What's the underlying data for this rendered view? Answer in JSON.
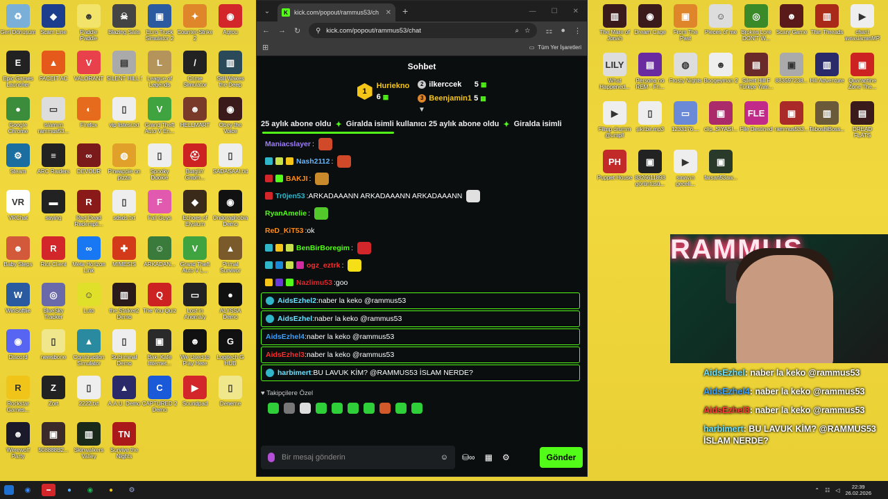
{
  "desktop": {
    "left_icons": [
      {
        "label": "Geri Dönüşüm",
        "color": "#7ab0d8",
        "glyph": "♻"
      },
      {
        "label": "Scam Line",
        "color": "#1c3e8c",
        "glyph": "◆"
      },
      {
        "label": "Paddle Paddle",
        "color": "#f2e46b",
        "glyph": "☻"
      },
      {
        "label": "Blazing Sails",
        "color": "#444",
        "glyph": "☠"
      },
      {
        "label": "Euro Truck Simulator 2",
        "color": "#2c5aa0",
        "glyph": "▣"
      },
      {
        "label": "Counter-Strike 2",
        "color": "#e0862a",
        "glyph": "✦"
      },
      {
        "label": "Agrou",
        "color": "#d2262a",
        "glyph": "◉"
      },
      {
        "label": "Epic Games Launcher",
        "color": "#222",
        "glyph": "E"
      },
      {
        "label": "FACEIT AC",
        "color": "#e55a1a",
        "glyph": "▲"
      },
      {
        "label": "VALORANT",
        "color": "#e8414b",
        "glyph": "V"
      },
      {
        "label": "SILENT HILL f",
        "color": "#aaa",
        "glyph": "▤"
      },
      {
        "label": "League of Legends",
        "color": "#b4945a",
        "glyph": "L"
      },
      {
        "label": "Crime Simulator",
        "color": "#222",
        "glyph": "/"
      },
      {
        "label": "Still Wakes the Deep",
        "color": "#2a4a5a",
        "glyph": "▥"
      },
      {
        "label": "Google Chrome",
        "color": "#3b8d3b",
        "glyph": "●"
      },
      {
        "label": "islamım rammus53...",
        "color": "#ddd",
        "glyph": "▭"
      },
      {
        "label": "Firefox",
        "color": "#e66b1c",
        "glyph": "◐"
      },
      {
        "label": "vip listesi.txt",
        "color": "#eee",
        "glyph": "▯"
      },
      {
        "label": "Grand Theft Auto V En...",
        "color": "#3fa33f",
        "glyph": "V"
      },
      {
        "label": "HELLMART",
        "color": "#7a3a2a",
        "glyph": "☻"
      },
      {
        "label": "Obey the Voice",
        "color": "#3a1a1a",
        "glyph": "◉"
      },
      {
        "label": "Steam",
        "color": "#1b6ea0",
        "glyph": "⚙"
      },
      {
        "label": "ARC Raiders",
        "color": "#222",
        "glyph": "≡"
      },
      {
        "label": "DEVOUR",
        "color": "#7a1a1a",
        "glyph": "∞"
      },
      {
        "label": "Pineapple on pizza",
        "color": "#e0a02a",
        "glyph": "◍"
      },
      {
        "label": "Spooky Dookie",
        "color": "#eee",
        "glyph": "▯"
      },
      {
        "label": "Burglin' Gnom...",
        "color": "#c22",
        "glyph": "⛑"
      },
      {
        "label": "SADASAAI.txt",
        "color": "#eee",
        "glyph": "▯"
      },
      {
        "label": "VRChat",
        "color": "#fff",
        "glyph": "VR"
      },
      {
        "label": "saying",
        "color": "#222",
        "glyph": "▬"
      },
      {
        "label": "Red Dead Redempti...",
        "color": "#8a1a1a",
        "glyph": "R"
      },
      {
        "label": "sdsds.txt",
        "color": "#eee",
        "glyph": "▯"
      },
      {
        "label": "Fall Guys",
        "color": "#e25ab0",
        "glyph": "F"
      },
      {
        "label": "Echoes of Elysium",
        "color": "#3a2a1a",
        "glyph": "◆"
      },
      {
        "label": "Ondoraphobia Demo",
        "color": "#111",
        "glyph": "◉"
      },
      {
        "label": "Baby Steps",
        "color": "#d25a3a",
        "glyph": "☻"
      },
      {
        "label": "Riot Client",
        "color": "#d2262a",
        "glyph": "R"
      },
      {
        "label": "Meta Horizon Link",
        "color": "#1877f2",
        "glyph": "∞"
      },
      {
        "label": "MIMESIS",
        "color": "#d23a1a",
        "glyph": "✚"
      },
      {
        "label": "ARKADAN...",
        "color": "#3a7a3a",
        "glyph": "☺"
      },
      {
        "label": "Grand Theft Auto V L...",
        "color": "#3fa33f",
        "glyph": "V"
      },
      {
        "label": "Primal Survivor",
        "color": "#7a5a2a",
        "glyph": "▲"
      },
      {
        "label": "WinSoftlie",
        "color": "#2a5aa0",
        "glyph": "W"
      },
      {
        "label": "BlueSky Tracker",
        "color": "#6a6aaa",
        "glyph": "◎"
      },
      {
        "label": "Luto",
        "color": "#e0e02a",
        "glyph": "☺"
      },
      {
        "label": "the Stalker2 Demo",
        "color": "#2a1a1a",
        "glyph": "▥"
      },
      {
        "label": "The You Quiz",
        "color": "#c22",
        "glyph": "Q"
      },
      {
        "label": "Lost in Anomaly",
        "color": "#222",
        "glyph": "▭"
      },
      {
        "label": "ALYSSA Demo",
        "color": "#111",
        "glyph": "●"
      },
      {
        "label": "Discord",
        "color": "#5865f2",
        "glyph": "◉"
      },
      {
        "label": "newsbone",
        "color": "#f0e68c",
        "glyph": "▯"
      },
      {
        "label": "Construction Simulator",
        "color": "#2a8aa0",
        "glyph": "▲"
      },
      {
        "label": "Subliminal Demo",
        "color": "#eee",
        "glyph": "▯"
      },
      {
        "label": "Bakı Kafe Internet...",
        "color": "#2a2a2a",
        "glyph": "▣"
      },
      {
        "label": "We Used to Play Here",
        "color": "#111",
        "glyph": "☻"
      },
      {
        "label": "Logitech G HUB",
        "color": "#111",
        "glyph": "G"
      },
      {
        "label": "Rockstar Games...",
        "color": "#f0c419",
        "glyph": "R"
      },
      {
        "label": "Zort",
        "color": "#222",
        "glyph": "Z"
      },
      {
        "label": "2222.txt",
        "color": "#eee",
        "glyph": "▯"
      },
      {
        "label": "A.A.U. Demo",
        "color": "#2a2a6a",
        "glyph": "▲"
      },
      {
        "label": "CAPTURED 2 Demo",
        "color": "#1a5ad8",
        "glyph": "C"
      },
      {
        "label": "Soundpad",
        "color": "#d2262a",
        "glyph": "▶"
      },
      {
        "label": "Deneme",
        "color": "#f0e68c",
        "glyph": "▯"
      },
      {
        "label": "Werewolf Party",
        "color": "#1a1a2a",
        "glyph": "☻"
      },
      {
        "label": "508888B2...",
        "color": "#3a2a2a",
        "glyph": "▣"
      },
      {
        "label": "Skinwalkers Valley",
        "color": "#1a2a1a",
        "glyph": "▥"
      },
      {
        "label": "Survive the Nights",
        "color": "#aa1a1a",
        "glyph": "TN"
      }
    ],
    "right_icons": [
      {
        "label": "The Mare of Jonah",
        "color": "#3a1a1a",
        "glyph": "▥"
      },
      {
        "label": "Dream Cage",
        "color": "#3a1a1a",
        "glyph": "◉"
      },
      {
        "label": "From The Past",
        "color": "#e0862a",
        "glyph": "▣"
      },
      {
        "label": "Pieces of me",
        "color": "#ddd",
        "glyph": "☺"
      },
      {
        "label": "Broken Lore DON'T W...",
        "color": "#3a8a2a",
        "glyph": "◎"
      },
      {
        "label": "Scary Game",
        "color": "#5a1a1a",
        "glyph": "☻"
      },
      {
        "label": "Thin Threads",
        "color": "#aa2a1a",
        "glyph": "▥"
      },
      {
        "label": "chant avrasiamınMP3",
        "color": "#eee",
        "glyph": "▶"
      },
      {
        "label": "What Happened...",
        "color": "#ddd",
        "glyph": "LILY"
      },
      {
        "label": "Persona no REM - Fri...",
        "color": "#6a2aa0",
        "glyph": "▤"
      },
      {
        "label": "Frosty Nights",
        "color": "#ddd",
        "glyph": "◍"
      },
      {
        "label": "Boogeyman 2",
        "color": "#eee",
        "glyph": "☻"
      },
      {
        "label": "Silent Hill F Türkçe Yam...",
        "color": "#6a2a2a",
        "glyph": "▤"
      },
      {
        "label": "883597238...",
        "color": "#aaa",
        "glyph": "▣"
      },
      {
        "label": "Hill Adventure",
        "color": "#2a2a6a",
        "glyph": "▥"
      },
      {
        "label": "Quarantine Zone The...",
        "color": "#c22",
        "glyph": "▣"
      },
      {
        "label": "Filmp drumm @umpl!",
        "color": "#eee",
        "glyph": "▶"
      },
      {
        "label": "şikitbir.mp3",
        "color": "#eee",
        "glyph": "▯"
      },
      {
        "label": "1233176....",
        "color": "#6a8ad8",
        "glyph": "▭"
      },
      {
        "label": "clip_SIYASI...",
        "color": "#aa2a6a",
        "glyph": "▣"
      },
      {
        "label": "File Destined",
        "color": "#c22a8a",
        "glyph": "FLE"
      },
      {
        "label": "rammus533...",
        "color": "#aa2a2a",
        "glyph": "▣"
      },
      {
        "label": "TaboshiBoss...",
        "color": "#6a5a3a",
        "glyph": "▥"
      },
      {
        "label": "DREAD FLATS",
        "color": "#3a1a1a",
        "glyph": "▤"
      },
      {
        "label": "Puppet House",
        "color": "#c22a2a",
        "glyph": "PH"
      },
      {
        "label": "8326611898 görüntüsü...",
        "color": "#222",
        "glyph": "▣"
      },
      {
        "label": "sınavın geceli...",
        "color": "#eee",
        "glyph": "▶"
      },
      {
        "label": "farsan53aw...",
        "color": "#2a3a2a",
        "glyph": "▣"
      }
    ]
  },
  "browser": {
    "tab_title": "kick.com/popout/rammus53/ch",
    "url": "kick.com/popout/rammus53/chat",
    "bookmarks_label": "Tüm Yer İşaretleri"
  },
  "chat": {
    "header": "Sohbet",
    "leaders": {
      "first": {
        "name": "Huriekno",
        "gifts": "6",
        "rank": "1"
      },
      "second": {
        "name": "ilkerccek",
        "gifts": "5",
        "rank": "2"
      },
      "third": {
        "name": "Beenjamin1",
        "gifts": "5",
        "rank": "3"
      }
    },
    "ticker": [
      "25 aylık abone oldu",
      "Giralda isimli kullanıcı 25 aylık abone oldu",
      "Giralda isimli"
    ],
    "messages": [
      {
        "user": "Maniacslayer",
        "color": "#9d7bff",
        "text": "",
        "badges": [],
        "emote": "#d04a2a"
      },
      {
        "user": "Nash2112",
        "color": "#63b6ff",
        "text": "",
        "badges": [
          "#2fb6c8",
          "#c8e04a",
          "#f5c518"
        ],
        "emote": "#d04a2a"
      },
      {
        "user": "BAKJI",
        "color": "#ff8c1a",
        "text": "",
        "badges": [
          "#d2262a",
          "#53fc18"
        ],
        "emote": "#c88a2a"
      },
      {
        "user": "Tr0jen53",
        "color": "#2fb6c8",
        "text": "ARKADAAANN  ARKADAAANN ARKADAAANN",
        "badges": [
          "#d2262a"
        ],
        "emote": "#e0e0e0"
      },
      {
        "user": "RyanAmelie",
        "color": "#53fc18",
        "text": "",
        "badges": [],
        "emote": "#53c82a"
      },
      {
        "user": "ReD_KiT53",
        "color": "#ff8c1a",
        "text": "ok",
        "badges": [],
        "emote": ""
      },
      {
        "user": "BenBirBoregim",
        "color": "#53fc18",
        "text": "",
        "badges": [
          "#2fb6c8",
          "#f5c518",
          "#c8e04a"
        ],
        "emote": "#d2262a"
      },
      {
        "user": "ogz_eztrk",
        "color": "#ff2a2a",
        "text": "",
        "badges": [
          "#2fb6c8",
          "#1a8ad8",
          "#c8e04a",
          "#d22aa0"
        ],
        "emote": "#f5e018"
      },
      {
        "user": "Nazlimu53",
        "color": "#e0262a",
        "text": "goo",
        "badges": [
          "#f5c518",
          "#6a3ad8",
          "#53fc18"
        ],
        "emote": ""
      }
    ],
    "highlighted": [
      {
        "user": "AidsEzhel2",
        "color": "#6ae0ff",
        "text": "naber la keko @rammus53",
        "icon": true
      },
      {
        "user": "AidsEzhel",
        "color": "#6ae0ff",
        "text": "naber la keko @rammus53",
        "icon": true
      },
      {
        "user": "AidsEzhel4",
        "color": "#3aa0ff",
        "text": "naber la keko @rammus53",
        "icon": false
      },
      {
        "user": "AidsEzhel3",
        "color": "#ff2a2a",
        "text": "naber la keko @rammus53",
        "icon": false
      },
      {
        "user": "harbimert",
        "color": "#6ae0ff",
        "text": "BU LAVUK KİM? @RAMMUS53 İSLAM NERDE?",
        "icon": true
      }
    ],
    "followers_label": "Takipçilere Özel",
    "input_placeholder": "Bir mesaj gönderin",
    "send_label": "Gönder"
  },
  "webcam": {
    "sign_text": "RAMMUS"
  },
  "overlay": [
    {
      "user": "AidsEzhel",
      "color": "#6ae0ff",
      "text": "naber la keko @rammus53"
    },
    {
      "user": "AidsEzhel4",
      "color": "#3aa0ff",
      "text": "naber la keko @rammus53"
    },
    {
      "user": "AidsEzhel3",
      "color": "#ff3a3a",
      "text": "naber la keko @rammus53"
    },
    {
      "user": "harbimert",
      "color": "#6ae0ff",
      "text": "BU LAVUK KİM? @RAMMUS53 İSLAM NERDE?"
    }
  ],
  "taskbar": {
    "time": "22:39",
    "date": "26.02.2026"
  }
}
